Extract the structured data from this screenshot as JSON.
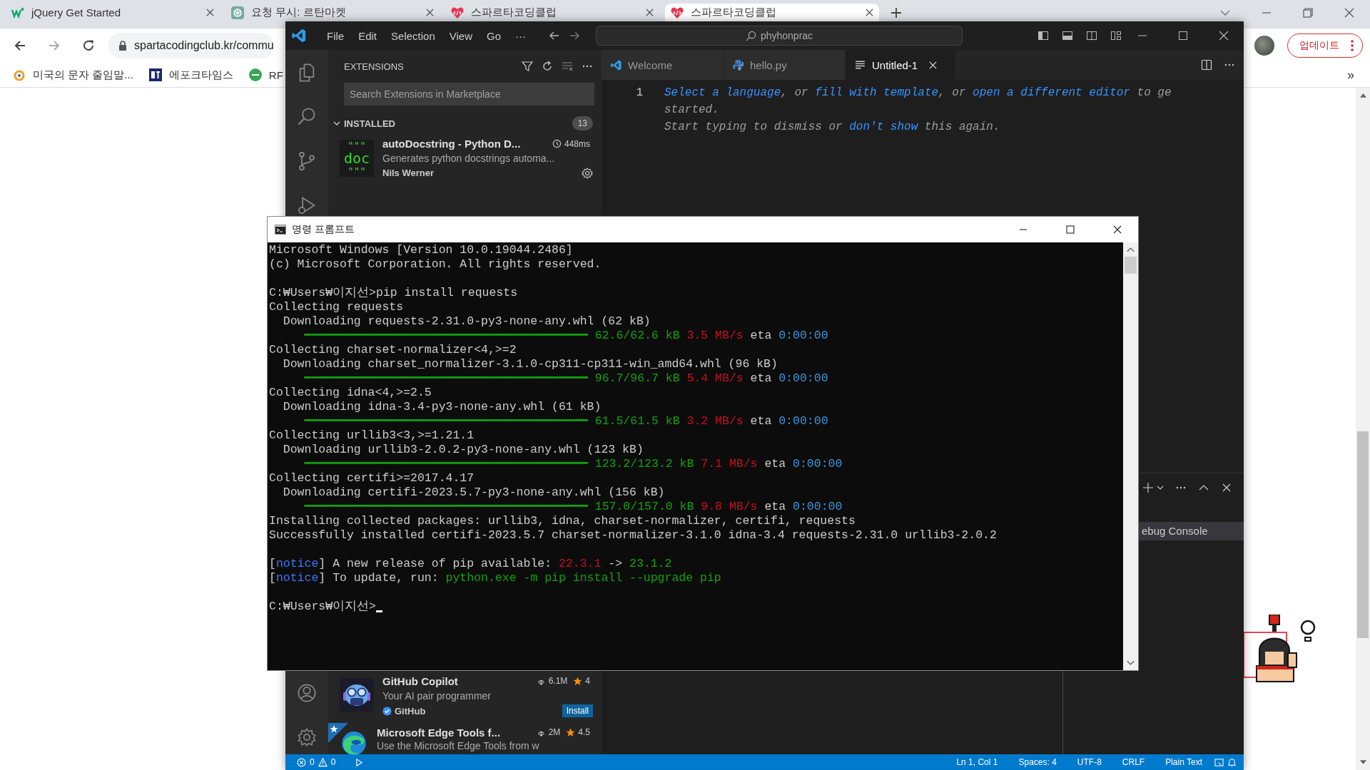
{
  "browser": {
    "tabs": [
      {
        "title": "jQuery Get Started",
        "selected": false
      },
      {
        "title": "요청 무시: 르탄마켓",
        "selected": false
      },
      {
        "title": "스파르타코딩클럽",
        "selected": false
      },
      {
        "title": "스파르타코딩클럽",
        "selected": true
      }
    ],
    "address": "spartacodingclub.kr/commu",
    "bookmarks": [
      {
        "label": "미국의 문자 줄임말..."
      },
      {
        "label": "에포크타임스"
      },
      {
        "label": "RF"
      }
    ],
    "update_button": "업데이트",
    "bookmarks_overflow": "»"
  },
  "vscode": {
    "menu": [
      "File",
      "Edit",
      "Selection",
      "View",
      "Go",
      "···"
    ],
    "search": "phyhonprac",
    "sidebar": {
      "title": "EXTENSIONS",
      "search_placeholder": "Search Extensions in Marketplace",
      "section": {
        "label": "INSTALLED",
        "count": "13",
        "expanded": true
      },
      "extensions": [
        {
          "kind": "installed",
          "logo_lines": [
            "\"\"\"",
            "doc",
            "\"\"\""
          ],
          "name": "autoDocstring - Python D...",
          "time": "448ms",
          "description": "Generates python docstrings automa...",
          "publisher": "Nils Werner",
          "verified": false,
          "featured": false
        },
        {
          "kind": "recommended",
          "name": "GitHub Copilot",
          "downloads": "6.1M",
          "rating": "4",
          "description": "Your AI pair programmer",
          "publisher": "GitHub",
          "verified": true,
          "featured": false,
          "install": "Install"
        },
        {
          "kind": "recommended",
          "name": "Microsoft Edge Tools f...",
          "downloads": "2M",
          "rating": "4.5",
          "description": "Use the Microsoft Edge Tools from w",
          "verified": false,
          "featured": true
        }
      ]
    },
    "tabs": [
      {
        "label": "Welcome",
        "selected": false
      },
      {
        "label": "hello.py",
        "selected": false
      },
      {
        "label": "Untitled-1",
        "selected": true
      }
    ],
    "line_number": "1",
    "hint": [
      [
        {
          "text": "Select a language",
          "link": true
        },
        {
          "text": ", or ",
          "link": false
        },
        {
          "text": "fill with template",
          "link": true
        },
        {
          "text": ", or ",
          "link": false
        },
        {
          "text": "open a different editor",
          "link": true
        },
        {
          "text": " to ge",
          "link": false
        }
      ],
      [
        {
          "text": "started.",
          "link": false
        }
      ],
      [
        {
          "text": "Start typing to dismiss or ",
          "link": false
        },
        {
          "text": "don't show",
          "link": true
        },
        {
          "text": " this again.",
          "link": false
        }
      ]
    ],
    "panel": {
      "terminal_tab": {
        "label": "ebug Console",
        "selected": true
      }
    },
    "status": {
      "errors": "0",
      "warnings": "0",
      "items": [
        "Ln 1, Col 1",
        "Spaces: 4",
        "UTF-8",
        "CRLF",
        "Plain Text"
      ]
    }
  },
  "cmd": {
    "title": "명령 프롬프트",
    "blocks": [
      {
        "lines": [
          {
            "segments": [
              {
                "text": "Microsoft Windows [Version 10.0.19044.2486]",
                "kind": "plain"
              }
            ]
          },
          {
            "segments": [
              {
                "text": "(c) Microsoft Corporation. All rights reserved.",
                "kind": "plain"
              }
            ]
          }
        ]
      },
      {
        "lines": [
          {
            "segments": [
              {
                "text": "C:₩Users₩이지선>pip install requests",
                "kind": "plain"
              }
            ]
          },
          {
            "segments": [
              {
                "text": "Collecting requests",
                "kind": "plain"
              }
            ]
          },
          {
            "segments": [
              {
                "text": "  Downloading requests-2.31.0-py3-none-any.whl (62 kB)",
                "kind": "plain"
              }
            ]
          },
          {
            "segments": [
              {
                "text": "     ━━━━━━━━━━━━━━━━━━━━━━━━━━━━━━━━━━━━━━━━ 62.6/62.6 kB ",
                "kind": "ok"
              },
              {
                "text": "3.5 MB/s",
                "kind": "warn"
              },
              {
                "text": " eta ",
                "kind": "plain"
              },
              {
                "text": "0:00:00",
                "kind": "time"
              }
            ]
          },
          {
            "segments": [
              {
                "text": "Collecting charset-normalizer<4,>=2",
                "kind": "plain"
              }
            ]
          },
          {
            "segments": [
              {
                "text": "  Downloading charset_normalizer-3.1.0-cp311-cp311-win_amd64.whl (96 kB)",
                "kind": "plain"
              }
            ]
          },
          {
            "segments": [
              {
                "text": "     ━━━━━━━━━━━━━━━━━━━━━━━━━━━━━━━━━━━━━━━━ 96.7/96.7 kB ",
                "kind": "ok"
              },
              {
                "text": "5.4 MB/s",
                "kind": "warn"
              },
              {
                "text": " eta ",
                "kind": "plain"
              },
              {
                "text": "0:00:00",
                "kind": "time"
              }
            ]
          },
          {
            "segments": [
              {
                "text": "Collecting idna<4,>=2.5",
                "kind": "plain"
              }
            ]
          },
          {
            "segments": [
              {
                "text": "  Downloading idna-3.4-py3-none-any.whl (61 kB)",
                "kind": "plain"
              }
            ]
          },
          {
            "segments": [
              {
                "text": "     ━━━━━━━━━━━━━━━━━━━━━━━━━━━━━━━━━━━━━━━━ 61.5/61.5 kB ",
                "kind": "ok"
              },
              {
                "text": "3.2 MB/s",
                "kind": "warn"
              },
              {
                "text": " eta ",
                "kind": "plain"
              },
              {
                "text": "0:00:00",
                "kind": "time"
              }
            ]
          },
          {
            "segments": [
              {
                "text": "Collecting urllib3<3,>=1.21.1",
                "kind": "plain"
              }
            ]
          },
          {
            "segments": [
              {
                "text": "  Downloading urllib3-2.0.2-py3-none-any.whl (123 kB)",
                "kind": "plain"
              }
            ]
          },
          {
            "segments": [
              {
                "text": "     ━━━━━━━━━━━━━━━━━━━━━━━━━━━━━━━━━━━━━━━━ 123.2/123.2 kB ",
                "kind": "ok"
              },
              {
                "text": "7.1 MB/s",
                "kind": "warn"
              },
              {
                "text": " eta ",
                "kind": "plain"
              },
              {
                "text": "0:00:00",
                "kind": "time"
              }
            ]
          },
          {
            "segments": [
              {
                "text": "Collecting certifi>=2017.4.17",
                "kind": "plain"
              }
            ]
          },
          {
            "segments": [
              {
                "text": "  Downloading certifi-2023.5.7-py3-none-any.whl (156 kB)",
                "kind": "plain"
              }
            ]
          },
          {
            "segments": [
              {
                "text": "     ━━━━━━━━━━━━━━━━━━━━━━━━━━━━━━━━━━━━━━━━ 157.0/157.0 kB ",
                "kind": "ok"
              },
              {
                "text": "9.8 MB/s",
                "kind": "warn"
              },
              {
                "text": " eta ",
                "kind": "plain"
              },
              {
                "text": "0:00:00",
                "kind": "time"
              }
            ]
          },
          {
            "segments": [
              {
                "text": "Installing collected packages: urllib3, idna, charset-normalizer, certifi, requests",
                "kind": "plain"
              }
            ]
          },
          {
            "segments": [
              {
                "text": "Successfully installed certifi-2023.5.7 charset-normalizer-3.1.0 idna-3.4 requests-2.31.0 urllib3-2.0.2",
                "kind": "plain"
              }
            ]
          }
        ]
      },
      {
        "lines": [
          {
            "segments": [
              {
                "text": "[",
                "kind": "plain"
              },
              {
                "text": "notice",
                "kind": "tag"
              },
              {
                "text": "] A new release of pip available: ",
                "kind": "plain"
              },
              {
                "text": "22.3.1",
                "kind": "warn"
              },
              {
                "text": " -> ",
                "kind": "plain"
              },
              {
                "text": "23.1.2",
                "kind": "ok"
              }
            ]
          },
          {
            "segments": [
              {
                "text": "[",
                "kind": "plain"
              },
              {
                "text": "notice",
                "kind": "tag"
              },
              {
                "text": "] To update, run: ",
                "kind": "plain"
              },
              {
                "text": "python.exe -m pip install --upgrade pip",
                "kind": "ok"
              }
            ]
          }
        ]
      },
      {
        "lines": [
          {
            "cursor": true,
            "segments": [
              {
                "text": "C:₩Users₩이지선>",
                "kind": "plain"
              }
            ]
          }
        ]
      }
    ]
  }
}
